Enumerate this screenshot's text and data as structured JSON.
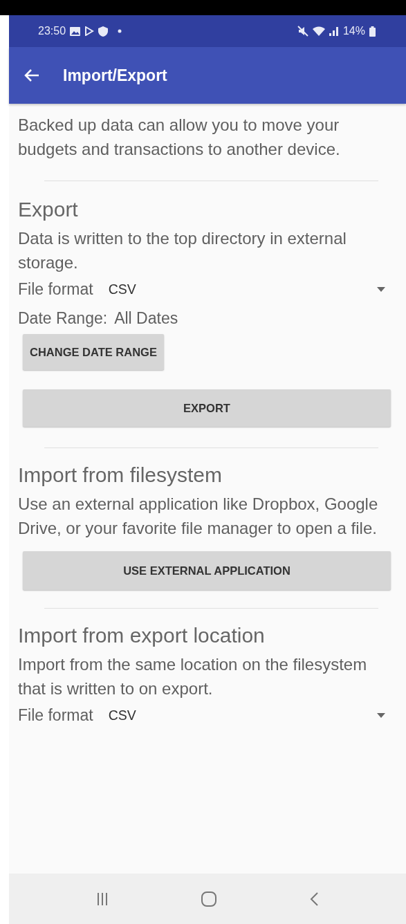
{
  "status_bar": {
    "time": "23:50",
    "battery": "14%"
  },
  "app_bar": {
    "title": "Import/Export"
  },
  "intro": "Backed up data can allow you to move your budgets and transactions to another device.",
  "sections": [
    {
      "kind": "export",
      "title": "Export",
      "description": "Data is written to the top directory in external storage.",
      "format_label": "File format",
      "format_value": "CSV",
      "date_range_label": "Date Range:",
      "date_range_value": "All Dates",
      "small_button": "CHANGE DATE RANGE",
      "button": "EXPORT"
    },
    {
      "kind": "external",
      "title": "Import from filesystem",
      "description": "Use an external application like Dropbox, Google Drive, or your favorite file manager to open a file.",
      "button": "USE EXTERNAL APPLICATION"
    },
    {
      "kind": "location",
      "title": "Import from export location",
      "description": "Import from the same location on the filesystem that is written to on export.",
      "format_label": "File format",
      "format_value": "CSV"
    }
  ]
}
